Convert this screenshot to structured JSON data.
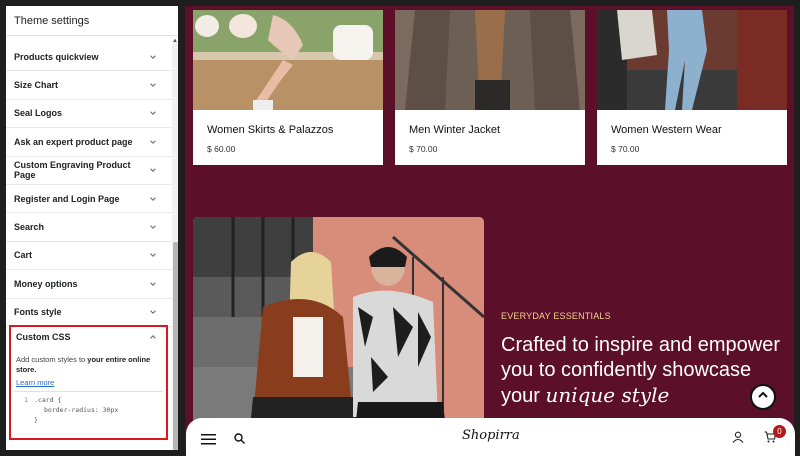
{
  "sidebar": {
    "title": "Theme settings",
    "items": [
      {
        "label": "Products quickview"
      },
      {
        "label": "Size Chart"
      },
      {
        "label": "Seal Logos"
      },
      {
        "label": "Ask an expert product page"
      },
      {
        "label": "Custom Engraving Product Page"
      },
      {
        "label": "Register and Login Page"
      },
      {
        "label": "Search"
      },
      {
        "label": "Cart"
      },
      {
        "label": "Money options"
      },
      {
        "label": "Fonts style"
      }
    ],
    "custom_css": {
      "label": "Custom CSS",
      "description_prefix": "Add custom styles to ",
      "description_bold": "your entire online store.",
      "learn_more": "Learn more",
      "code": {
        "line1_no": "1",
        "line1": ".card {",
        "line2": "border-radius: 30px",
        "line3": "}"
      }
    }
  },
  "preview": {
    "products": [
      {
        "title": "Women Skirts & Palazzos",
        "price": "$ 60.00"
      },
      {
        "title": "Men Winter Jacket",
        "price": "$ 70.00"
      },
      {
        "title": "Women Western Wear",
        "price": "$ 70.00"
      }
    ],
    "hero": {
      "eyebrow": "EVERYDAY ESSENTIALS",
      "headline_main": "Crafted to inspire and empower you to confidently showcase your ",
      "headline_italic": "unique style"
    },
    "bottom_bar": {
      "logo": "Shopirra",
      "cart_count": "0"
    }
  },
  "colors": {
    "preview_bg": "#5b0f29",
    "eyebrow": "#f2d28c",
    "highlight_border": "#d71920",
    "badge": "#b11a1a"
  },
  "icons": [
    "chevron-down-icon",
    "chevron-up-icon",
    "menu-icon",
    "search-icon",
    "user-icon",
    "cart-icon",
    "arrow-up-icon"
  ]
}
